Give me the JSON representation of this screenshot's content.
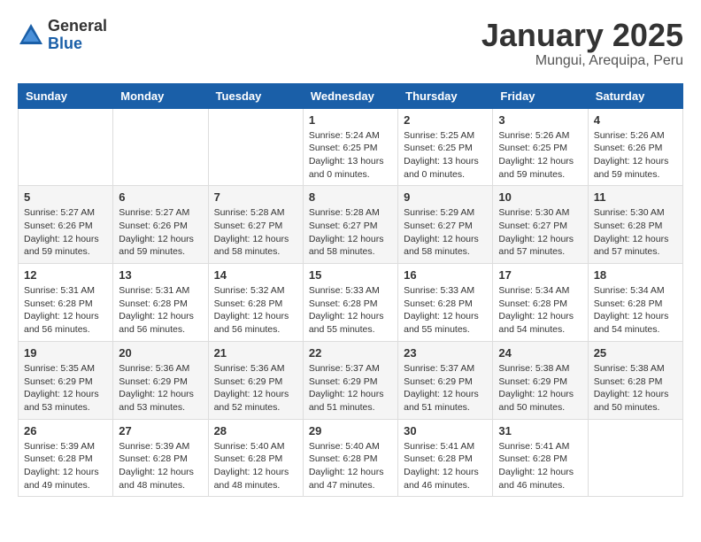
{
  "header": {
    "logo_general": "General",
    "logo_blue": "Blue",
    "month_title": "January 2025",
    "location": "Mungui, Arequipa, Peru"
  },
  "weekdays": [
    "Sunday",
    "Monday",
    "Tuesday",
    "Wednesday",
    "Thursday",
    "Friday",
    "Saturday"
  ],
  "weeks": [
    [
      {
        "day": "",
        "info": ""
      },
      {
        "day": "",
        "info": ""
      },
      {
        "day": "",
        "info": ""
      },
      {
        "day": "1",
        "info": "Sunrise: 5:24 AM\nSunset: 6:25 PM\nDaylight: 13 hours\nand 0 minutes."
      },
      {
        "day": "2",
        "info": "Sunrise: 5:25 AM\nSunset: 6:25 PM\nDaylight: 13 hours\nand 0 minutes."
      },
      {
        "day": "3",
        "info": "Sunrise: 5:26 AM\nSunset: 6:25 PM\nDaylight: 12 hours\nand 59 minutes."
      },
      {
        "day": "4",
        "info": "Sunrise: 5:26 AM\nSunset: 6:26 PM\nDaylight: 12 hours\nand 59 minutes."
      }
    ],
    [
      {
        "day": "5",
        "info": "Sunrise: 5:27 AM\nSunset: 6:26 PM\nDaylight: 12 hours\nand 59 minutes."
      },
      {
        "day": "6",
        "info": "Sunrise: 5:27 AM\nSunset: 6:26 PM\nDaylight: 12 hours\nand 59 minutes."
      },
      {
        "day": "7",
        "info": "Sunrise: 5:28 AM\nSunset: 6:27 PM\nDaylight: 12 hours\nand 58 minutes."
      },
      {
        "day": "8",
        "info": "Sunrise: 5:28 AM\nSunset: 6:27 PM\nDaylight: 12 hours\nand 58 minutes."
      },
      {
        "day": "9",
        "info": "Sunrise: 5:29 AM\nSunset: 6:27 PM\nDaylight: 12 hours\nand 58 minutes."
      },
      {
        "day": "10",
        "info": "Sunrise: 5:30 AM\nSunset: 6:27 PM\nDaylight: 12 hours\nand 57 minutes."
      },
      {
        "day": "11",
        "info": "Sunrise: 5:30 AM\nSunset: 6:28 PM\nDaylight: 12 hours\nand 57 minutes."
      }
    ],
    [
      {
        "day": "12",
        "info": "Sunrise: 5:31 AM\nSunset: 6:28 PM\nDaylight: 12 hours\nand 56 minutes."
      },
      {
        "day": "13",
        "info": "Sunrise: 5:31 AM\nSunset: 6:28 PM\nDaylight: 12 hours\nand 56 minutes."
      },
      {
        "day": "14",
        "info": "Sunrise: 5:32 AM\nSunset: 6:28 PM\nDaylight: 12 hours\nand 56 minutes."
      },
      {
        "day": "15",
        "info": "Sunrise: 5:33 AM\nSunset: 6:28 PM\nDaylight: 12 hours\nand 55 minutes."
      },
      {
        "day": "16",
        "info": "Sunrise: 5:33 AM\nSunset: 6:28 PM\nDaylight: 12 hours\nand 55 minutes."
      },
      {
        "day": "17",
        "info": "Sunrise: 5:34 AM\nSunset: 6:28 PM\nDaylight: 12 hours\nand 54 minutes."
      },
      {
        "day": "18",
        "info": "Sunrise: 5:34 AM\nSunset: 6:28 PM\nDaylight: 12 hours\nand 54 minutes."
      }
    ],
    [
      {
        "day": "19",
        "info": "Sunrise: 5:35 AM\nSunset: 6:29 PM\nDaylight: 12 hours\nand 53 minutes."
      },
      {
        "day": "20",
        "info": "Sunrise: 5:36 AM\nSunset: 6:29 PM\nDaylight: 12 hours\nand 53 minutes."
      },
      {
        "day": "21",
        "info": "Sunrise: 5:36 AM\nSunset: 6:29 PM\nDaylight: 12 hours\nand 52 minutes."
      },
      {
        "day": "22",
        "info": "Sunrise: 5:37 AM\nSunset: 6:29 PM\nDaylight: 12 hours\nand 51 minutes."
      },
      {
        "day": "23",
        "info": "Sunrise: 5:37 AM\nSunset: 6:29 PM\nDaylight: 12 hours\nand 51 minutes."
      },
      {
        "day": "24",
        "info": "Sunrise: 5:38 AM\nSunset: 6:29 PM\nDaylight: 12 hours\nand 50 minutes."
      },
      {
        "day": "25",
        "info": "Sunrise: 5:38 AM\nSunset: 6:28 PM\nDaylight: 12 hours\nand 50 minutes."
      }
    ],
    [
      {
        "day": "26",
        "info": "Sunrise: 5:39 AM\nSunset: 6:28 PM\nDaylight: 12 hours\nand 49 minutes."
      },
      {
        "day": "27",
        "info": "Sunrise: 5:39 AM\nSunset: 6:28 PM\nDaylight: 12 hours\nand 48 minutes."
      },
      {
        "day": "28",
        "info": "Sunrise: 5:40 AM\nSunset: 6:28 PM\nDaylight: 12 hours\nand 48 minutes."
      },
      {
        "day": "29",
        "info": "Sunrise: 5:40 AM\nSunset: 6:28 PM\nDaylight: 12 hours\nand 47 minutes."
      },
      {
        "day": "30",
        "info": "Sunrise: 5:41 AM\nSunset: 6:28 PM\nDaylight: 12 hours\nand 46 minutes."
      },
      {
        "day": "31",
        "info": "Sunrise: 5:41 AM\nSunset: 6:28 PM\nDaylight: 12 hours\nand 46 minutes."
      },
      {
        "day": "",
        "info": ""
      }
    ]
  ]
}
